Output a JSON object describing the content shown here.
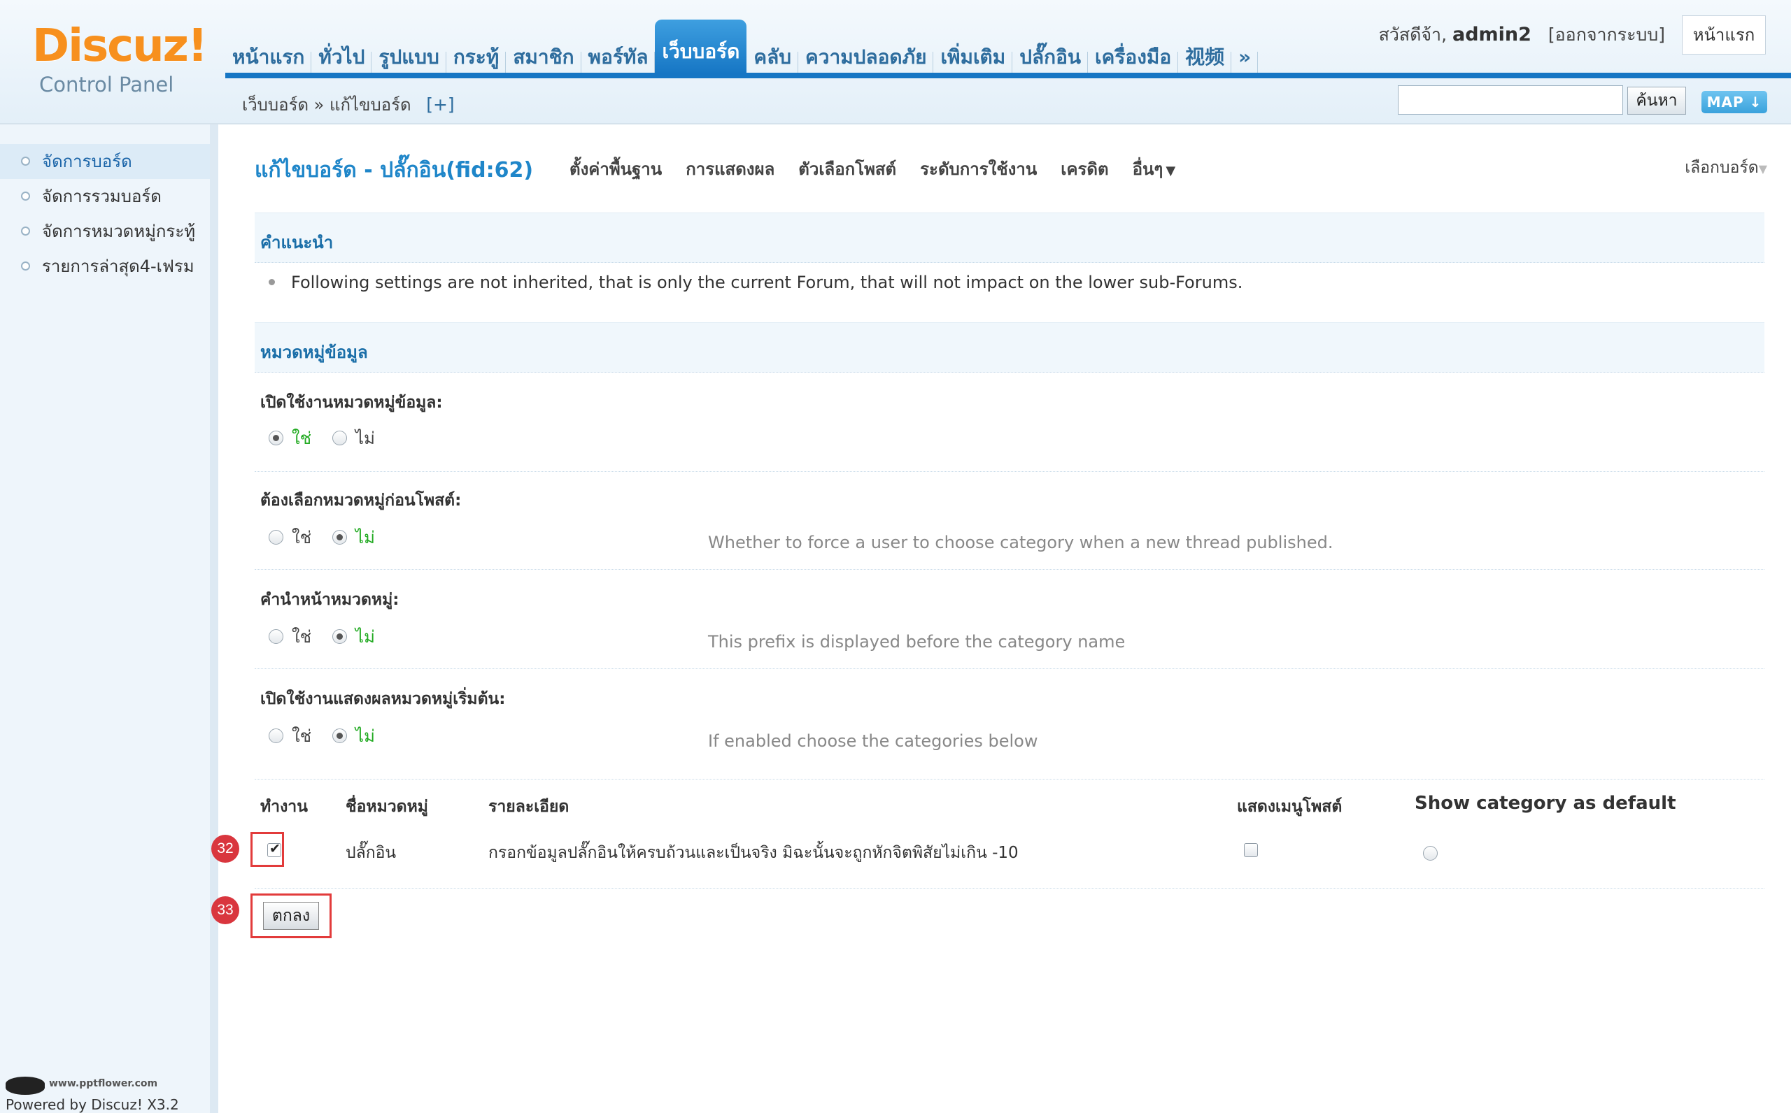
{
  "header": {
    "logo_main": "Discuz!",
    "logo_sub": "Control Panel",
    "nav": [
      "หน้าแรก",
      "ทั่วไป",
      "รูปแบบ",
      "กระทู้",
      "สมาชิก",
      "พอร์ทัล",
      "เว็บบอร์ด",
      "คลับ",
      "ความปลอดภัย",
      "เพิ่มเติม",
      "ปลั๊กอิน",
      "เครื่องมือ",
      "视频"
    ],
    "nav_active": "เว็บบอร์ด",
    "nav_more": "»",
    "greeting": "สวัสดีจ้า,",
    "username": "admin2",
    "logout": "[ออกจากระบบ]",
    "home_button": "หน้าแรก",
    "breadcrumb": "เว็บบอร์ด » แก้ไขบอร์ด",
    "breadcrumb_plus": "[+]",
    "search_value": "",
    "search_button": "ค้นหา",
    "map_button": "MAP ↓"
  },
  "sidebar": {
    "items": [
      "จัดการบอร์ด",
      "จัดการรวมบอร์ด",
      "จัดการหมวดหมู่กระทู้",
      "รายการล่าสุด4-เฟรม"
    ],
    "active": "จัดการบอร์ด",
    "powered": "Powered by Discuz! X3.2",
    "watermark": "www.pptflower.com"
  },
  "main": {
    "title": "แก้ไขบอร์ด - ปลั๊กอิน(fid:62)",
    "tabs": [
      "ตั้งค่าพื้นฐาน",
      "การแสดงผล",
      "ตัวเลือกโพสต์",
      "ระดับการใช้งาน",
      "เครดิต",
      "อื่นๆ"
    ],
    "tab_caret": "▼",
    "select_forum": "เลือกบอร์ด",
    "tips_title": "คำแนะนำ",
    "tips_text": "Following settings are not inherited, that is only the current Forum, that will not impact on the lower sub-Forums.",
    "section_title": "หมวดหมู่ข้อมูล",
    "yes": "ใช่",
    "no": "ไม่",
    "settings": [
      {
        "label": "เปิดใช้งานหมวดหมู่ข้อมูล:",
        "value": "yes",
        "help": ""
      },
      {
        "label": "ต้องเลือกหมวดหมู่ก่อนโพสต์:",
        "value": "no",
        "help": "Whether to force a user to choose category when a new thread published."
      },
      {
        "label": "คำนำหน้าหมวดหมู่:",
        "value": "no",
        "help": "This prefix is displayed before the category name"
      },
      {
        "label": "เปิดใช้งานแสดงผลหมวดหมู่เริ่มต้น:",
        "value": "no",
        "help": "If enabled choose the categories below"
      }
    ],
    "table": {
      "headers": [
        "ทำงาน",
        "ชื่อหมวดหมู่",
        "รายละเอียด",
        "แสดงเมนูโพสต์",
        "Show category as default"
      ],
      "rows": [
        {
          "enabled": true,
          "name": "ปลั๊กอิน",
          "detail": "กรอกข้อมูลปลั๊กอินให้ครบถ้วนและเป็นจริง มิฉะนั้นจะถูกหักจิตพิสัยไม่เกิน -10",
          "show_menu": false,
          "default": false
        }
      ]
    },
    "submit": "ตกลง",
    "annotations": [
      "32",
      "33"
    ]
  }
}
